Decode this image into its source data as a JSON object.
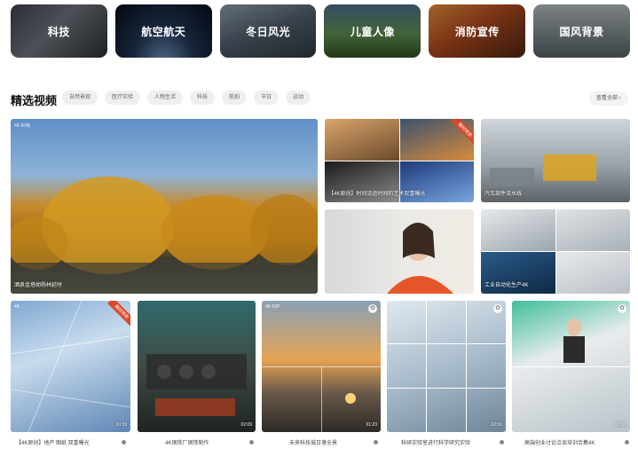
{
  "categories": [
    "科技",
    "航空航天",
    "冬日风光",
    "儿童人像",
    "消防宣传",
    "国风背景"
  ],
  "section": {
    "title": "精选视频",
    "tags": [
      "自然景观",
      "医疗实验",
      "人物生活",
      "科技",
      "航拍",
      "节日",
      "运动"
    ],
    "see_all": "查看全部 ›"
  },
  "cards": {
    "autumn": {
      "res": "4K  60帧",
      "caption": "酒泉金塔胡杨林延时"
    },
    "art_gate": {
      "caption": "【4K原创】时间流逝时间的艺术双重曝光",
      "ribbon": "限时特卖"
    },
    "auto_line": {
      "caption": "汽车部件流水线"
    },
    "woman": {
      "caption": ""
    },
    "automation": {
      "caption": "工业自动化生产4K"
    },
    "b1": {
      "res": "4K",
      "duration": "00:39",
      "ribbon": "限时特卖",
      "label": "【4K原创】地产 图纸 双重曝光"
    },
    "b2": {
      "duration": "02:09",
      "label": "4K钢铁厂钢铁制作"
    },
    "b3": {
      "res": "4K  50P",
      "duration": "01:23",
      "label": "未来科技城日落全景"
    },
    "b4": {
      "duration": "02:00",
      "label": "科研实验室进行科学研究实验"
    },
    "b5": {
      "duration": "00:08",
      "label": "高端创业讨论洽谈培训合集4K"
    }
  },
  "colors": {
    "ribbon": "#d94a2a",
    "tag_bg": "#efefef"
  }
}
